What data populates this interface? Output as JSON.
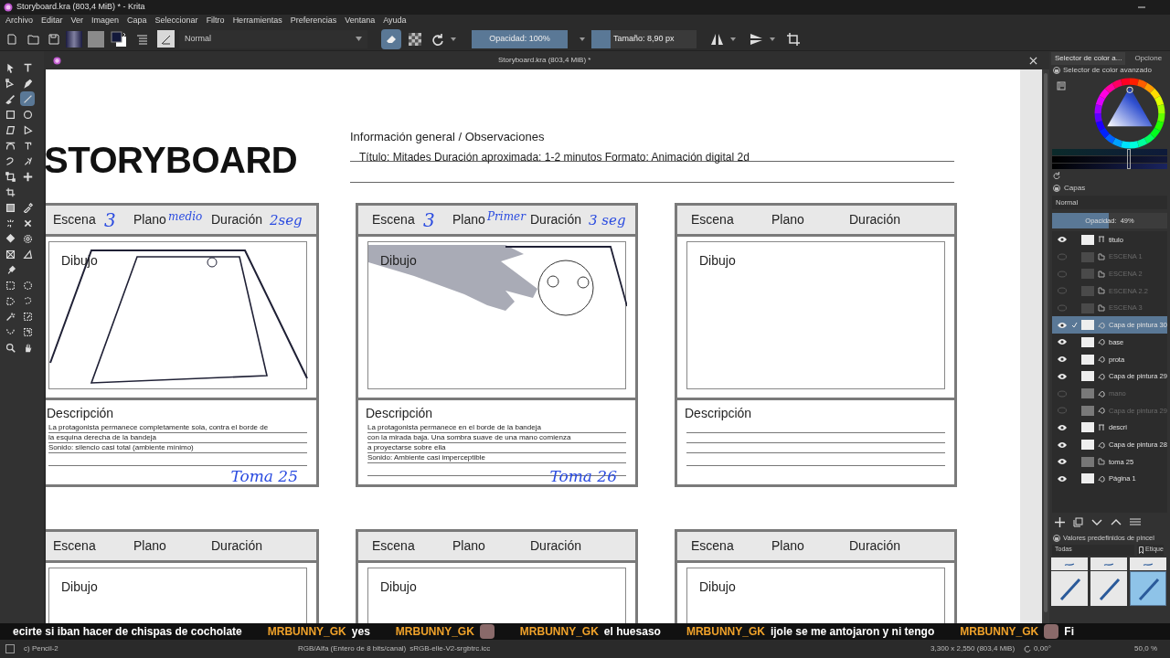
{
  "window": {
    "title": "Storyboard.kra (803,4 MiB) * - Krita"
  },
  "menu": [
    "Archivo",
    "Editar",
    "Ver",
    "Imagen",
    "Capa",
    "Seleccionar",
    "Filtro",
    "Herramientas",
    "Preferencias",
    "Ventana",
    "Ayuda"
  ],
  "toolbar": {
    "blend_mode": "Normal",
    "eraser_on": true,
    "opacity": {
      "label": "Opacidad: 100%",
      "level": 1
    },
    "size": {
      "label": "Tamaño: 8,90 px",
      "level": 0.18
    }
  },
  "toolbox": [
    {
      "kind": "pointer",
      "selected": false
    },
    {
      "kind": "text",
      "selected": false
    },
    {
      "kind": "shape",
      "selected": false
    },
    {
      "kind": "pen",
      "selected": false
    },
    {
      "kind": "brush",
      "selected": false
    },
    {
      "kind": "line",
      "selected": true
    },
    {
      "kind": "rect",
      "selected": false
    },
    {
      "kind": "ellipse",
      "selected": false
    },
    {
      "kind": "polygon",
      "selected": false
    },
    {
      "kind": "polyline",
      "selected": false
    },
    {
      "kind": "bezier",
      "selected": false
    },
    {
      "kind": "freepath",
      "selected": false
    },
    {
      "kind": "curve",
      "selected": false
    },
    {
      "kind": "multibrush",
      "selected": false
    },
    {
      "kind": "transform",
      "selected": false
    },
    {
      "kind": "move",
      "selected": false
    },
    {
      "kind": "crop",
      "selected": false
    },
    {
      "kind": "gradient",
      "selected": false
    },
    {
      "kind": "picker",
      "selected": false
    },
    {
      "kind": "patch",
      "selected": false
    },
    {
      "kind": "cross",
      "selected": false
    },
    {
      "kind": "fill",
      "selected": false
    },
    {
      "kind": "enclose",
      "selected": false
    },
    {
      "kind": "assistant",
      "selected": false
    },
    {
      "kind": "measure",
      "selected": false
    },
    {
      "kind": "pin",
      "selected": false
    },
    {
      "kind": "rectsel",
      "selected": false
    },
    {
      "kind": "ellipsesel",
      "selected": false
    },
    {
      "kind": "polysel",
      "selected": false
    },
    {
      "kind": "freesel",
      "selected": false
    },
    {
      "kind": "wand",
      "selected": false
    },
    {
      "kind": "similar",
      "selected": false
    },
    {
      "kind": "beziersel",
      "selected": false
    },
    {
      "kind": "pathsel",
      "selected": false
    },
    {
      "kind": "zoom",
      "selected": false
    },
    {
      "kind": "hand",
      "selected": false
    }
  ],
  "document_tab": {
    "title": "Storyboard.kra (803,4 MiB) *"
  },
  "canvas": {
    "heading": "STORYBOARD",
    "info_title": "Información general / Observaciones",
    "info_text": "Título: Mitades Duración aproximada: 1-2 minutos Formato: Animación digital 2d",
    "panel_rows": [
      [
        {
          "scene_label": "Escena",
          "scene": "3",
          "plane_label": "Plano",
          "plane": "medio",
          "duration_label": "Duración",
          "duration": "2seg",
          "drawing_label": "Dibujo",
          "kind": "tray",
          "description_label": "Descripción",
          "description": [
            "La protagonista permanece completamente sola, contra el borde de",
            "la esquina derecha de la bandeja",
            "Sonido: silencio casi total (ambiente mínimo)"
          ],
          "take": "Toma 25"
        },
        {
          "scene_label": "Escena",
          "scene": "3",
          "plane_label": "Plano",
          "plane": "Primer",
          "duration_label": "Duración",
          "duration": "3 seg",
          "drawing_label": "Dibujo",
          "kind": "hand",
          "description_label": "Descripción",
          "description": [
            "La protagonista permanece en el borde de la bandeja",
            "con la mirada baja. Una sombra suave de una mano comienza",
            "a proyectarse sobre ella",
            "Sonido: Ambiente casi imperceptible"
          ],
          "take": "Toma 26"
        },
        {
          "scene_label": "Escena",
          "plane_label": "Plano",
          "duration_label": "Duración",
          "drawing_label": "Dibujo",
          "description_label": "Descripción"
        }
      ],
      [
        {
          "scene_label": "Escena",
          "plane_label": "Plano",
          "duration_label": "Duración",
          "drawing_label": "Dibujo"
        },
        {
          "scene_label": "Escena",
          "plane_label": "Plano",
          "duration_label": "Duración",
          "drawing_label": "Dibujo"
        },
        {
          "scene_label": "Escena",
          "plane_label": "Plano",
          "duration_label": "Duración",
          "drawing_label": "Dibujo"
        }
      ]
    ]
  },
  "color_docker": {
    "tabs": [
      {
        "label": "Selector de color a...",
        "selected": true
      },
      {
        "label": "Opcione",
        "selected": false
      }
    ],
    "title": "Selector de color avanzado"
  },
  "layers": {
    "title": "Capas",
    "blend_mode": "Normal",
    "opacity": {
      "label": "Opacidad:  49%",
      "level": 0.49
    },
    "items": [
      {
        "name": "titulo",
        "kind": "vector",
        "visible": true,
        "selected": false
      },
      {
        "name": "ESCENA 1",
        "kind": "group",
        "visible": false,
        "selected": false
      },
      {
        "name": "ESCENA 2",
        "kind": "group",
        "visible": false,
        "selected": false
      },
      {
        "name": "ESCENA 2.2",
        "kind": "group",
        "visible": false,
        "selected": false
      },
      {
        "name": "ESCENA 3",
        "kind": "group",
        "visible": false,
        "selected": false
      },
      {
        "name": "Capa de pintura 30",
        "kind": "paint",
        "visible": true,
        "selected": true
      },
      {
        "name": "base",
        "kind": "paint",
        "visible": true,
        "selected": false
      },
      {
        "name": "prota",
        "kind": "paint",
        "visible": true,
        "selected": false
      },
      {
        "name": "Capa de pintura 29",
        "kind": "paint",
        "visible": true,
        "selected": false
      },
      {
        "name": "mano",
        "kind": "paint",
        "visible": false,
        "selected": false
      },
      {
        "name": "Capa de pintura 29",
        "kind": "paint",
        "visible": false,
        "selected": false
      },
      {
        "name": "descri",
        "kind": "vector",
        "visible": true,
        "selected": false
      },
      {
        "name": "Capa de pintura 28",
        "kind": "paint",
        "visible": true,
        "selected": false
      },
      {
        "name": "toma 25",
        "kind": "group",
        "visible": true,
        "selected": false
      },
      {
        "name": "Página 1",
        "kind": "paint",
        "visible": true,
        "selected": false
      }
    ]
  },
  "brush_presets": {
    "title": "Valores predefinidos de pincel",
    "filter": "Todas",
    "tag_button": "Etique",
    "presets": [
      {
        "selected": false
      },
      {
        "selected": false
      },
      {
        "selected": false
      },
      {
        "selected": false
      },
      {
        "selected": false
      },
      {
        "selected": true
      }
    ]
  },
  "chat": [
    {
      "text": "ecirte si iban hacer de chispas de cocholate"
    },
    {
      "user": "MRBUNNY_GK",
      "text": "yes"
    },
    {
      "user": "MRBUNNY_GK",
      "avatar": true
    },
    {
      "user": "MRBUNNY_GK",
      "text": "el huesaso"
    },
    {
      "user": "MRBUNNY_GK",
      "text": "ijole se me antojaron y ni tengo"
    },
    {
      "user": "MRBUNNY_GK",
      "avatar": true,
      "text": "Fi"
    }
  ],
  "status_bar": {
    "brush": "c) Pencil-2",
    "color_model": "RGB/Alfa (Entero de 8 bits/canal)",
    "profile": "sRGB-elle-V2-srgbtrc.icc",
    "size": "3,300 x 2,550 (803,4 MiB)",
    "rotation": "0,00°",
    "zoom": "50,0 %"
  }
}
